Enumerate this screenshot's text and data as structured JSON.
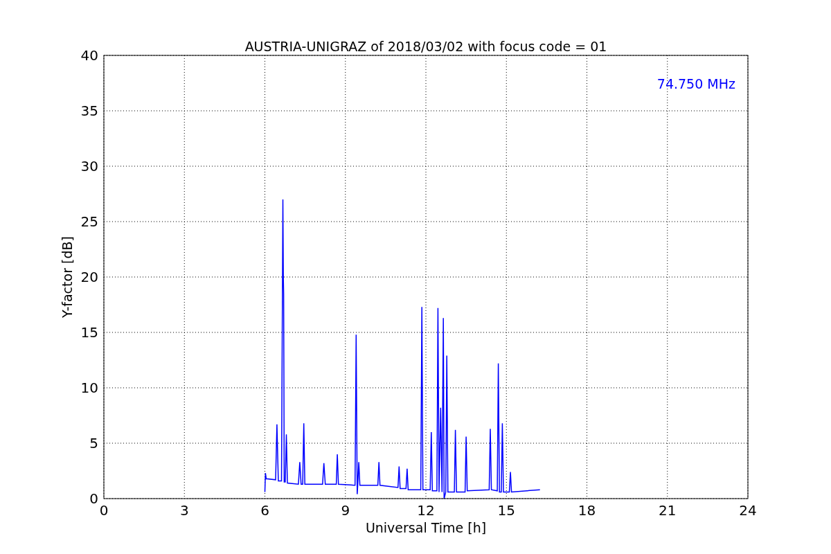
{
  "chart_data": {
    "type": "line",
    "title": "AUSTRIA-UNIGRAZ of 2018/03/02 with focus code = 01",
    "xlabel": "Universal Time [h]",
    "ylabel": "Y-factor [dB]",
    "x": [
      6.0,
      6.02,
      6.05,
      6.4,
      6.45,
      6.5,
      6.62,
      6.67,
      6.69,
      6.7,
      6.72,
      6.76,
      6.8,
      6.84,
      7.25,
      7.3,
      7.35,
      7.41,
      7.45,
      7.49,
      8.15,
      8.2,
      8.25,
      8.66,
      8.7,
      8.74,
      9.36,
      9.4,
      9.44,
      9.46,
      9.5,
      9.54,
      10.21,
      10.25,
      10.29,
      10.96,
      11.0,
      11.04,
      11.26,
      11.3,
      11.34,
      11.81,
      11.85,
      11.89,
      12.16,
      12.2,
      12.24,
      12.41,
      12.45,
      12.49,
      12.55,
      12.6,
      12.65,
      12.68,
      12.74,
      12.78,
      12.82,
      13.06,
      13.1,
      13.14,
      13.46,
      13.5,
      13.54,
      14.36,
      14.4,
      14.44,
      14.66,
      14.7,
      14.74,
      14.81,
      14.85,
      14.89,
      15.11,
      15.15,
      15.19,
      16.25
    ],
    "series": [
      {
        "name": "74.750 MHz",
        "color": "#0000ff",
        "values": [
          0.6,
          2.3,
          1.8,
          1.7,
          6.7,
          1.6,
          1.6,
          27.0,
          19.8,
          18.5,
          1.5,
          1.5,
          5.8,
          1.4,
          1.3,
          3.3,
          1.3,
          1.3,
          6.8,
          1.3,
          1.3,
          3.2,
          1.3,
          1.3,
          4.0,
          1.3,
          1.2,
          14.8,
          0.4,
          1.2,
          3.3,
          1.2,
          1.2,
          3.3,
          1.2,
          1.0,
          2.9,
          0.9,
          0.9,
          2.7,
          0.8,
          0.8,
          17.3,
          0.8,
          0.8,
          6.0,
          0.7,
          0.7,
          17.2,
          0.6,
          8.2,
          0.6,
          16.3,
          0.0,
          0.6,
          12.9,
          0.6,
          0.6,
          6.2,
          0.6,
          0.6,
          5.6,
          0.7,
          0.8,
          6.3,
          0.8,
          0.7,
          12.2,
          0.6,
          0.6,
          6.8,
          0.6,
          0.6,
          2.4,
          0.6,
          0.8
        ]
      }
    ],
    "xlim": [
      0,
      24
    ],
    "ylim": [
      0,
      40
    ],
    "xticks": [
      0,
      3,
      6,
      9,
      12,
      15,
      18,
      21,
      24
    ],
    "yticks": [
      0,
      5,
      10,
      15,
      20,
      25,
      30,
      35,
      40
    ],
    "grid": true
  }
}
